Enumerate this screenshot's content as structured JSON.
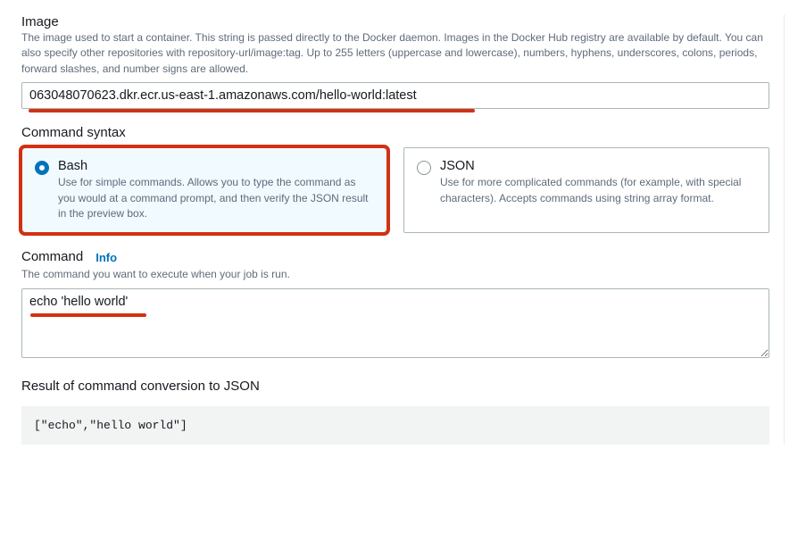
{
  "image": {
    "label": "Image",
    "description": "The image used to start a container. This string is passed directly to the Docker daemon. Images in the Docker Hub registry are available by default. You can also specify other repositories with repository-url/image:tag. Up to 255 letters (uppercase and lowercase), numbers, hyphens, underscores, colons, periods, forward slashes, and number signs are allowed.",
    "value": "063048070623.dkr.ecr.us-east-1.amazonaws.com/hello-world:latest"
  },
  "commandSyntax": {
    "label": "Command syntax",
    "options": {
      "bash": {
        "title": "Bash",
        "description": "Use for simple commands. Allows you to type the command as you would at a command prompt, and then verify the JSON result in the preview box.",
        "selected": true
      },
      "json": {
        "title": "JSON",
        "description": "Use for more complicated commands (for example, with special characters). Accepts commands using string array format.",
        "selected": false
      }
    }
  },
  "command": {
    "label": "Command",
    "infoLabel": "Info",
    "description": "The command you want to execute when your job is run.",
    "value": "echo 'hello world'"
  },
  "result": {
    "label": "Result of command conversion to JSON",
    "value": "[\"echo\",\"hello world\"]"
  }
}
